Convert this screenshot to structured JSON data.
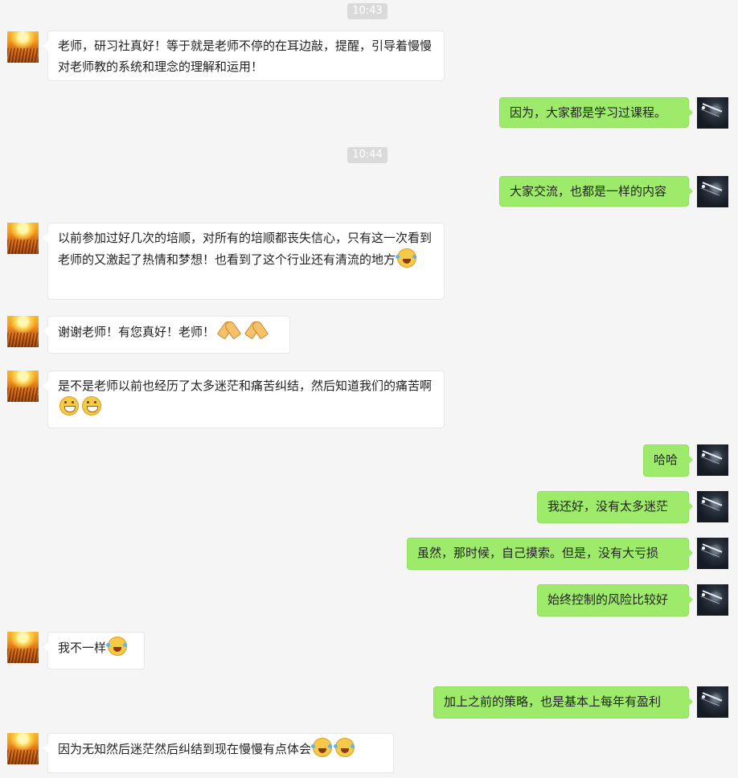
{
  "timestamps": [
    "10:43",
    "10:44"
  ],
  "messages": [
    {
      "side": "left",
      "text": "老师，研习社真好！等于就是老师不停的在耳边敲，提醒，引导着慢慢对老师教的系统和理念的理解和运用！",
      "emojis": []
    },
    {
      "side": "right",
      "text": "因为，大家都是学习过课程。",
      "emojis": []
    },
    {
      "side": "right",
      "text": "大家交流，也都是一样的内容",
      "emojis": []
    },
    {
      "side": "left",
      "text": "以前参加过好几次的培顺，对所有的培顺都丧失信心，只有这一次看到老师的又激起了热情和梦想！也看到了这个行业还有清流的地方",
      "emojis": [
        "laugh-cry-emoji"
      ]
    },
    {
      "side": "left",
      "text": "谢谢老师！有您真好！老师！",
      "emojis": [
        "clap-emoji",
        "clap-emoji"
      ]
    },
    {
      "side": "left",
      "text": "是不是老师以前也经历了太多迷茫和痛苦纠结，然后知道我们的痛苦啊",
      "emojis": [
        "grin-emoji",
        "grin-emoji"
      ]
    },
    {
      "side": "right",
      "text": "哈哈",
      "emojis": []
    },
    {
      "side": "right",
      "text": "我还好，没有太多迷茫",
      "emojis": []
    },
    {
      "side": "right",
      "text": "虽然，那时候，自己摸索。但是，没有大亏损",
      "emojis": []
    },
    {
      "side": "right",
      "text": "始终控制的风险比较好",
      "emojis": []
    },
    {
      "side": "left",
      "text": "我不一样",
      "emojis": [
        "laugh-cry-emoji"
      ]
    },
    {
      "side": "right",
      "text": "加上之前的策略，也是基本上每年有盈利",
      "emojis": []
    },
    {
      "side": "left",
      "text": "因为无知然后迷茫然后纠结到现在慢慢有点体会",
      "emojis": [
        "laugh-cry-emoji",
        "laugh-cry-emoji"
      ]
    }
  ],
  "colors": {
    "background": "#f5f5f5",
    "bubble_left": "#ffffff",
    "bubble_right": "#9eea6a",
    "timestamp_bg": "#dadada"
  },
  "icons": {
    "left_avatar": "sunset-field-avatar",
    "right_avatar": "dark-night-avatar"
  }
}
